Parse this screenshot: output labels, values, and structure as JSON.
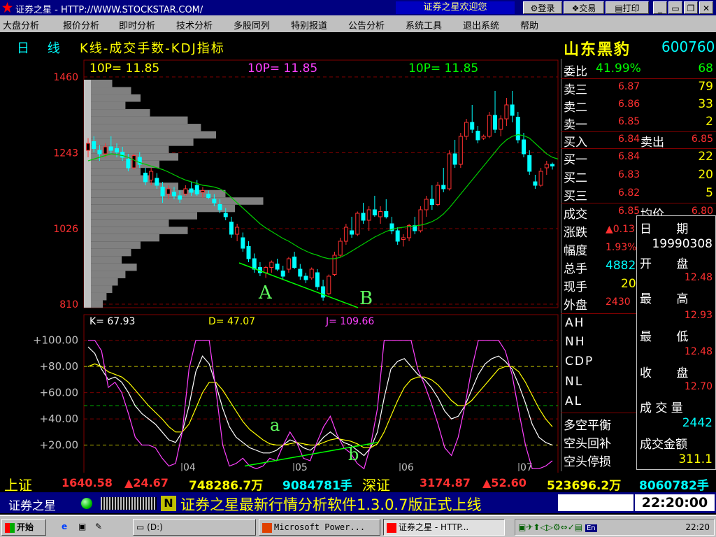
{
  "window": {
    "title": "证券之星 - HTTP://WWW.STOCKSTAR.COM/",
    "welcome": "证券之星欢迎您",
    "buttons": {
      "login": "登录",
      "trade": "交易",
      "print": "打印"
    }
  },
  "menu": [
    "大盘分析",
    "报价分析",
    "即时分析",
    "技术分析",
    "多股同列",
    "特别报道",
    "公告分析",
    "系统工具",
    "退出系统",
    "帮助"
  ],
  "header": {
    "period": "日 线",
    "indicator": "K线-成交手数-KDJ指标",
    "stock_name": "山东黑豹",
    "stock_code": "600760"
  },
  "ma_labels": [
    "10P= 11.85",
    "10P= 11.85",
    "10P= 11.85"
  ],
  "kdj_labels": {
    "k": "K= 67.93",
    "d": "D= 47.07",
    "j": "J= 109.66"
  },
  "annotations": {
    "A": "A",
    "B": "B",
    "a": "a",
    "b": "b"
  },
  "quote_panel": {
    "ratio": {
      "label": "委比",
      "pct": "41.99%",
      "value": "68"
    },
    "sells": [
      {
        "label": "卖三",
        "price": "6.87",
        "vol": "79"
      },
      {
        "label": "卖二",
        "price": "6.86",
        "vol": "33"
      },
      {
        "label": "卖一",
        "price": "6.85",
        "vol": "2"
      }
    ],
    "buyin": {
      "label": "买入",
      "price": "6.84",
      "sell_label": "卖出",
      "sell_price": "6.85"
    },
    "buys": [
      {
        "label": "买一",
        "price": "6.84",
        "vol": "22"
      },
      {
        "label": "买二",
        "price": "6.83",
        "vol": "20"
      },
      {
        "label": "买三",
        "price": "6.82",
        "vol": "5"
      }
    ],
    "trade": {
      "label": "成交",
      "value": "6.85",
      "avg_label": "均价",
      "avg": "6.80"
    },
    "change": {
      "label": "涨跌",
      "value": "▲0.13"
    },
    "amplitude": {
      "label": "幅度",
      "value": "1.93%"
    },
    "total": {
      "label": "总手",
      "value": "4882"
    },
    "current": {
      "label": "现手",
      "value": "20"
    },
    "outer": {
      "label": "外盘",
      "value": "2430"
    },
    "indicators": [
      "AH",
      "NH",
      "CDP",
      "NL",
      "AL"
    ],
    "signals": [
      "多空平衡",
      "空头回补",
      "空头停损"
    ]
  },
  "popup": {
    "date_label": "日 期",
    "date": "19990308",
    "open_label": "开 盘",
    "open": "12.48",
    "high_label": "最 高",
    "high": "12.93",
    "low_label": "最 低",
    "low": "12.48",
    "close_label": "收 盘",
    "close": "12.70",
    "vol_label": "成 交 量",
    "vol": "2442",
    "amt_label": "成交金额",
    "amt": "311.1"
  },
  "ticker": {
    "sh_label": "上证",
    "sh_index": "1640.58",
    "sh_change": "▲24.67",
    "sh_amount": "748286.7万",
    "sh_vol": "9084781手",
    "sz_label": "深证",
    "sz_index": "3174.87",
    "sz_change": "▲52.60",
    "sz_amount": "523696.2万",
    "sz_vol": "8060782手"
  },
  "status": {
    "brand": "证券之星",
    "n_icon": "N",
    "message": "证券之星最新行情分析软件1.3.0.7版正式上线",
    "time": "22:20:00"
  },
  "taskbar": {
    "start": "开始",
    "drive": "(D:)",
    "ppt": "Microsoft Power...",
    "app": "证券之星 - HTTP...",
    "clock": "22:20"
  },
  "colors": {
    "up": "#ff3030",
    "down": "#00ffff",
    "ma": "#00cc00",
    "k_line": "#ffffff",
    "d_line": "#ffff00",
    "j_line": "#ff40ff",
    "grid": "#800000"
  },
  "chart_data": [
    {
      "type": "candlestick",
      "ylabel_ticks": [
        "1460",
        "1243",
        "1026",
        "810"
      ],
      "ylim": [
        800,
        1480
      ],
      "x_ticks": [
        "04",
        "05",
        "06",
        "07"
      ],
      "series": [
        {
          "name": "10P",
          "type": "line"
        }
      ],
      "ohlc": [
        [
          1250,
          1285,
          1230,
          1270
        ],
        [
          1275,
          1290,
          1245,
          1255
        ],
        [
          1250,
          1265,
          1220,
          1240
        ],
        [
          1240,
          1270,
          1230,
          1260
        ],
        [
          1260,
          1290,
          1240,
          1250
        ],
        [
          1255,
          1270,
          1230,
          1245
        ],
        [
          1245,
          1260,
          1220,
          1230
        ],
        [
          1225,
          1240,
          1190,
          1200
        ],
        [
          1200,
          1240,
          1195,
          1235
        ],
        [
          1230,
          1245,
          1200,
          1210
        ],
        [
          1185,
          1200,
          1150,
          1160
        ],
        [
          1165,
          1200,
          1150,
          1190
        ],
        [
          1170,
          1185,
          1140,
          1150
        ],
        [
          1145,
          1160,
          1100,
          1120
        ],
        [
          1125,
          1150,
          1110,
          1140
        ],
        [
          1130,
          1145,
          1110,
          1120
        ],
        [
          1120,
          1135,
          1100,
          1110
        ],
        [
          1125,
          1150,
          1120,
          1140
        ],
        [
          1140,
          1160,
          1120,
          1130
        ],
        [
          1150,
          1165,
          1120,
          1125
        ],
        [
          1130,
          1145,
          1115,
          1135
        ],
        [
          1125,
          1135,
          1110,
          1115
        ],
        [
          1110,
          1125,
          1090,
          1100
        ],
        [
          1095,
          1110,
          1070,
          1080
        ],
        [
          1070,
          1085,
          1050,
          1060
        ],
        [
          1045,
          1060,
          1000,
          1010
        ],
        [
          1010,
          1040,
          990,
          1030
        ],
        [
          1000,
          1015,
          960,
          970
        ],
        [
          975,
          990,
          930,
          940
        ],
        [
          940,
          955,
          900,
          910
        ],
        [
          915,
          930,
          890,
          900
        ],
        [
          900,
          920,
          885,
          915
        ],
        [
          915,
          935,
          900,
          930
        ],
        [
          925,
          940,
          905,
          910
        ],
        [
          905,
          920,
          880,
          890
        ],
        [
          910,
          945,
          900,
          940
        ],
        [
          945,
          960,
          910,
          915
        ],
        [
          910,
          925,
          880,
          890
        ],
        [
          890,
          900,
          870,
          880
        ],
        [
          885,
          915,
          880,
          910
        ],
        [
          900,
          910,
          850,
          860
        ],
        [
          860,
          880,
          820,
          830
        ],
        [
          840,
          895,
          835,
          890
        ],
        [
          895,
          960,
          890,
          950
        ],
        [
          950,
          1000,
          945,
          990
        ],
        [
          990,
          1040,
          980,
          1030
        ],
        [
          1020,
          1060,
          1000,
          1010
        ],
        [
          1010,
          1075,
          1005,
          1070
        ],
        [
          1070,
          1100,
          1040,
          1050
        ],
        [
          1050,
          1090,
          1020,
          1080
        ],
        [
          1080,
          1120,
          1060,
          1065
        ],
        [
          1060,
          1090,
          1040,
          1075
        ],
        [
          1075,
          1110,
          1055,
          1060
        ],
        [
          1040,
          1060,
          1010,
          1020
        ],
        [
          1020,
          1030,
          980,
          990
        ],
        [
          995,
          1010,
          975,
          1000
        ],
        [
          1000,
          1040,
          990,
          1035
        ],
        [
          1035,
          1060,
          1010,
          1020
        ],
        [
          1020,
          1090,
          1015,
          1080
        ],
        [
          1080,
          1120,
          1060,
          1110
        ],
        [
          1110,
          1150,
          1080,
          1095
        ],
        [
          1095,
          1160,
          1090,
          1150
        ],
        [
          1150,
          1200,
          1130,
          1140
        ],
        [
          1140,
          1250,
          1135,
          1240
        ],
        [
          1240,
          1280,
          1200,
          1210
        ],
        [
          1210,
          1300,
          1200,
          1290
        ],
        [
          1290,
          1340,
          1280,
          1330
        ],
        [
          1330,
          1380,
          1300,
          1310
        ],
        [
          1305,
          1320,
          1270,
          1280
        ],
        [
          1285,
          1295,
          1280,
          1290
        ],
        [
          1290,
          1360,
          1285,
          1350
        ],
        [
          1350,
          1420,
          1300,
          1310
        ],
        [
          1310,
          1350,
          1290,
          1340
        ],
        [
          1340,
          1400,
          1320,
          1380
        ],
        [
          1380,
          1420,
          1330,
          1350
        ],
        [
          1345,
          1360,
          1270,
          1280
        ],
        [
          1280,
          1300,
          1230,
          1240
        ],
        [
          1235,
          1250,
          1180,
          1190
        ],
        [
          1160,
          1180,
          1140,
          1150
        ],
        [
          1150,
          1200,
          1145,
          1190
        ],
        [
          1200,
          1220,
          1180,
          1210
        ],
        [
          1210,
          1215,
          1195,
          1205
        ]
      ],
      "ma": [
        1220,
        1225,
        1230,
        1235,
        1240,
        1238,
        1235,
        1230,
        1222,
        1215,
        1210,
        1205,
        1200,
        1195,
        1188,
        1180,
        1172,
        1165,
        1160,
        1155,
        1150,
        1148,
        1145,
        1140,
        1130,
        1115,
        1100,
        1085,
        1070,
        1055,
        1040,
        1028,
        1018,
        1008,
        998,
        990,
        980,
        970,
        962,
        955,
        950,
        944,
        940,
        940,
        944,
        952,
        962,
        972,
        982,
        992,
        1002,
        1010,
        1018,
        1024,
        1028,
        1030,
        1032,
        1034,
        1036,
        1040,
        1046,
        1055,
        1068,
        1085,
        1105,
        1125,
        1145,
        1165,
        1185,
        1205,
        1225,
        1245,
        1265,
        1280,
        1290,
        1295,
        1292,
        1285,
        1270,
        1255,
        1240,
        1230,
        1225
      ]
    },
    {
      "type": "line",
      "ylabel_ticks": [
        "+100.00",
        "+80.00",
        "+60.00",
        "+40.00",
        "+20.00"
      ],
      "ylim": [
        0,
        110
      ],
      "x_ticks": [
        "04",
        "05",
        "06",
        "07"
      ],
      "series": [
        {
          "name": "K",
          "values": [
            95,
            90,
            78,
            70,
            72,
            68,
            60,
            50,
            44,
            40,
            36,
            30,
            24,
            22,
            30,
            50,
            76,
            88,
            82,
            66,
            48,
            34,
            26,
            22,
            18,
            16,
            14,
            14,
            16,
            20,
            24,
            22,
            18,
            16,
            20,
            26,
            30,
            26,
            22,
            20,
            16,
            12,
            18,
            30,
            56,
            78,
            84,
            86,
            80,
            74,
            70,
            64,
            56,
            46,
            40,
            42,
            50,
            62,
            74,
            82,
            86,
            88,
            84,
            78,
            66,
            52,
            36,
            26,
            22,
            20
          ]
        },
        {
          "name": "D",
          "values": [
            80,
            82,
            80,
            76,
            74,
            72,
            68,
            62,
            56,
            50,
            45,
            40,
            34,
            30,
            30,
            36,
            48,
            60,
            68,
            68,
            62,
            54,
            46,
            38,
            32,
            28,
            24,
            21,
            20,
            20,
            21,
            22,
            21,
            20,
            20,
            22,
            24,
            25,
            24,
            23,
            21,
            18,
            18,
            21,
            30,
            42,
            54,
            64,
            70,
            72,
            72,
            70,
            66,
            60,
            54,
            50,
            50,
            54,
            60,
            66,
            72,
            78,
            80,
            80,
            76,
            68,
            58,
            48,
            40,
            34
          ]
        },
        {
          "name": "J",
          "values": [
            100,
            100,
            92,
            64,
            68,
            60,
            44,
            26,
            20,
            20,
            18,
            10,
            4,
            6,
            30,
            78,
            100,
            100,
            100,
            62,
            20,
            4,
            6,
            10,
            4,
            2,
            4,
            10,
            8,
            20,
            30,
            22,
            10,
            8,
            22,
            34,
            42,
            28,
            18,
            14,
            6,
            2,
            20,
            48,
            100,
            100,
            100,
            100,
            100,
            78,
            66,
            52,
            36,
            18,
            12,
            26,
            50,
            78,
            100,
            100,
            100,
            100,
            92,
            74,
            46,
            20,
            2,
            2,
            4,
            8
          ]
        }
      ]
    }
  ]
}
